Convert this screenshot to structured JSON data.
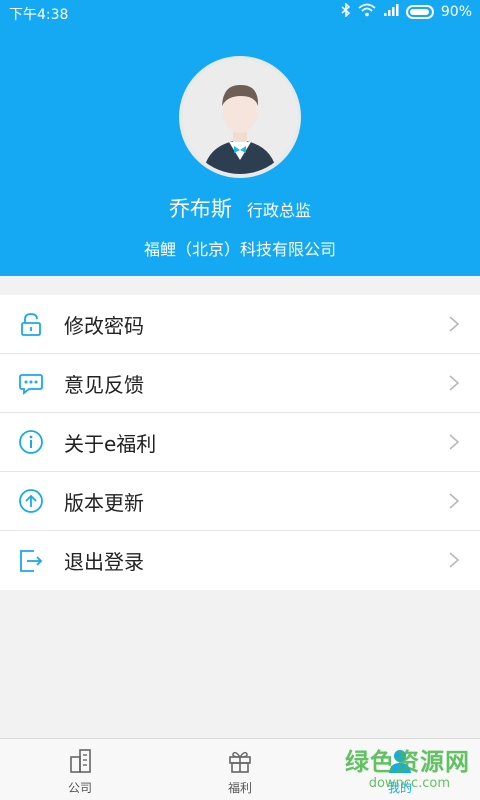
{
  "status_bar": {
    "time": "下午4:38",
    "battery": "90%",
    "battery_level": 0.9
  },
  "profile": {
    "name": "乔布斯",
    "title": "行政总监",
    "company": "福鲤（北京）科技有限公司"
  },
  "menu": [
    {
      "label": "修改密码",
      "icon": "lock-icon"
    },
    {
      "label": "意见反馈",
      "icon": "chat-bubble-icon"
    },
    {
      "label": "关于e福利",
      "icon": "info-icon"
    },
    {
      "label": "版本更新",
      "icon": "upgrade-arrow-icon"
    },
    {
      "label": "退出登录",
      "icon": "logout-icon"
    }
  ],
  "tabs": [
    {
      "label": "公司",
      "icon": "building-icon",
      "active": false
    },
    {
      "label": "福利",
      "icon": "gift-icon",
      "active": false
    },
    {
      "label": "我的",
      "icon": "person-icon",
      "active": true
    }
  ],
  "watermark": {
    "title": "绿色资源网",
    "subtitle": "downcc.com"
  },
  "colors": {
    "primary": "#16a9f3",
    "background": "#f2f2f2",
    "watermark": "#49b84a"
  }
}
